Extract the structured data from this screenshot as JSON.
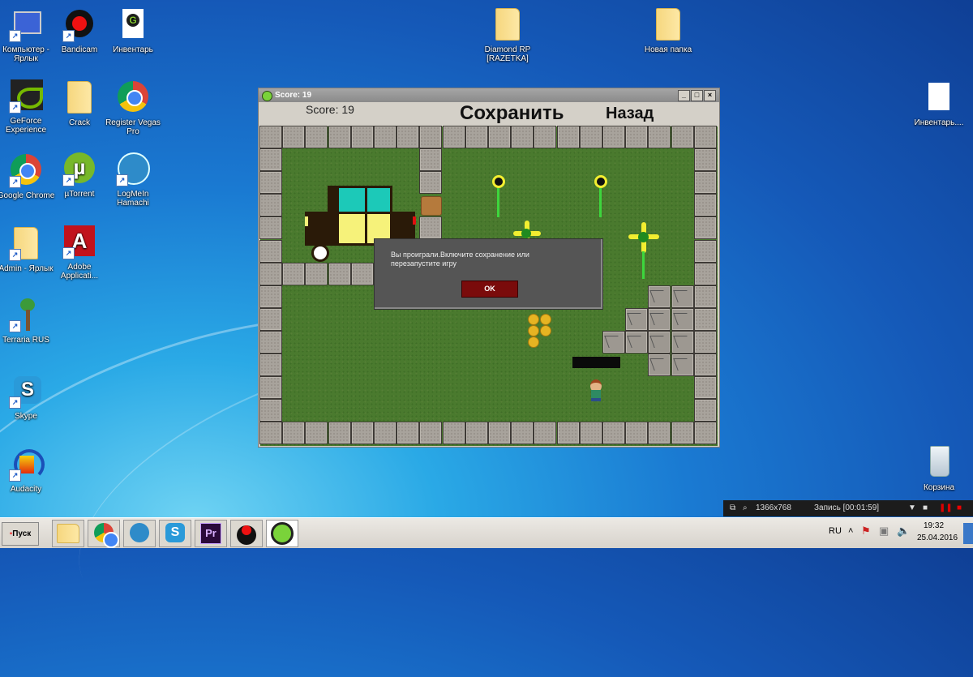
{
  "desktop": {
    "icons": [
      {
        "label": "Компьютер - Ярлык",
        "icon": "computer-icon"
      },
      {
        "label": "Bandicam",
        "icon": "bandicam-icon"
      },
      {
        "label": "Инвентарь",
        "icon": "inventory-app-icon"
      },
      {
        "label": "GeForce Experience",
        "icon": "geforce-icon"
      },
      {
        "label": "Crack",
        "icon": "folder-icon"
      },
      {
        "label": "Register Vegas Pro",
        "icon": "chrome-icon"
      },
      {
        "label": "Google Chrome",
        "icon": "chrome-icon"
      },
      {
        "label": "µTorrent",
        "icon": "utorrent-icon"
      },
      {
        "label": "LogMeIn Hamachi",
        "icon": "hamachi-icon"
      },
      {
        "label": "Admin - Ярлык",
        "icon": "user-folder-icon"
      },
      {
        "label": "Adobe Applicati...",
        "icon": "adobe-icon"
      },
      {
        "label": "Terraria RUS",
        "icon": "terraria-icon"
      },
      {
        "label": "Skype",
        "icon": "skype-icon"
      },
      {
        "label": "Audacity",
        "icon": "audacity-icon"
      },
      {
        "label": "Diamond RP [RAZETKA]",
        "icon": "folder-icon"
      },
      {
        "label": "Новая папка",
        "icon": "folder-icon"
      },
      {
        "label": "Инвентарь....",
        "icon": "text-file-icon"
      },
      {
        "label": "Корзина",
        "icon": "recycle-bin-icon"
      }
    ]
  },
  "window": {
    "title": "Score: 19",
    "score_label": "Score: 19",
    "save_label": "Сохранить",
    "back_label": "Назад",
    "minimize": "_",
    "maximize": "□",
    "close": "×"
  },
  "dialog": {
    "message": "Вы проиграли.Включите сохранение или перезапустите игру",
    "ok_label": "OK"
  },
  "recorder": {
    "resolution": "1366x768",
    "recording": "Запись [00:01:59]"
  },
  "taskbar": {
    "start_label": "Пуск",
    "apps": [
      "explorer",
      "chrome",
      "hamachi",
      "skype",
      "premiere",
      "bandicam",
      "game"
    ],
    "premiere_label": "Pr",
    "skype_label": "S",
    "language": "RU",
    "time": "19:32",
    "date": "25.04.2016"
  }
}
